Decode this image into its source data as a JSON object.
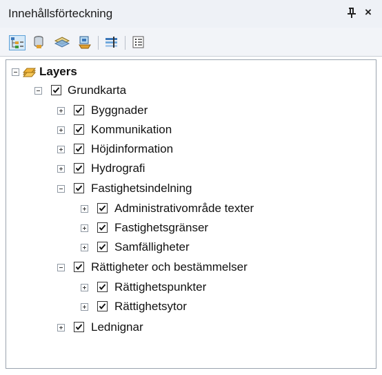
{
  "window": {
    "title": "Innehållsförteckning",
    "pin_glyph": "ᵖ",
    "close_glyph": "×"
  },
  "toolbar": {
    "buttons": [
      {
        "name": "list-by-drawing-order",
        "icon": "drawing-order-icon",
        "active": true
      },
      {
        "name": "list-by-source",
        "icon": "database-icon",
        "active": false
      },
      {
        "name": "list-by-visibility",
        "icon": "layers-visibility-icon",
        "active": false
      },
      {
        "name": "list-by-selection",
        "icon": "selection-icon",
        "active": false
      },
      {
        "name": "show-hide-layers",
        "icon": "layer-toggle-icon",
        "active": false
      },
      {
        "name": "options",
        "icon": "options-icon",
        "active": false
      }
    ]
  },
  "tree": {
    "root": {
      "label": "Layers",
      "expanded": true
    },
    "items": [
      {
        "label": "Grundkarta",
        "level": 1,
        "expanded": true,
        "checked": true
      },
      {
        "label": "Byggnader",
        "level": 2,
        "expanded": false,
        "checked": true
      },
      {
        "label": "Kommunikation",
        "level": 2,
        "expanded": false,
        "checked": true
      },
      {
        "label": "Höjdinformation",
        "level": 2,
        "expanded": false,
        "checked": true
      },
      {
        "label": "Hydrografi",
        "level": 2,
        "expanded": false,
        "checked": true
      },
      {
        "label": "Fastighetsindelning",
        "level": 2,
        "expanded": true,
        "checked": true
      },
      {
        "label": "Administrativområde texter",
        "level": 3,
        "expanded": false,
        "checked": true
      },
      {
        "label": "Fastighetsgränser",
        "level": 3,
        "expanded": false,
        "checked": true
      },
      {
        "label": "Samfälligheter",
        "level": 3,
        "expanded": false,
        "checked": true
      },
      {
        "label": "Rättigheter och bestämmelser",
        "level": 2,
        "expanded": true,
        "checked": true
      },
      {
        "label": "Rättighetspunkter",
        "level": 3,
        "expanded": false,
        "checked": true
      },
      {
        "label": "Rättighetsytor",
        "level": 3,
        "expanded": false,
        "checked": true
      },
      {
        "label": "Lednignar",
        "level": 2,
        "expanded": false,
        "checked": true
      }
    ]
  },
  "colors": {
    "titlebar": "#eef1f6",
    "toolbar": "#f2f4f8",
    "active_tool_border": "#5aa0d8",
    "layers_icon": "#f0b43a"
  }
}
